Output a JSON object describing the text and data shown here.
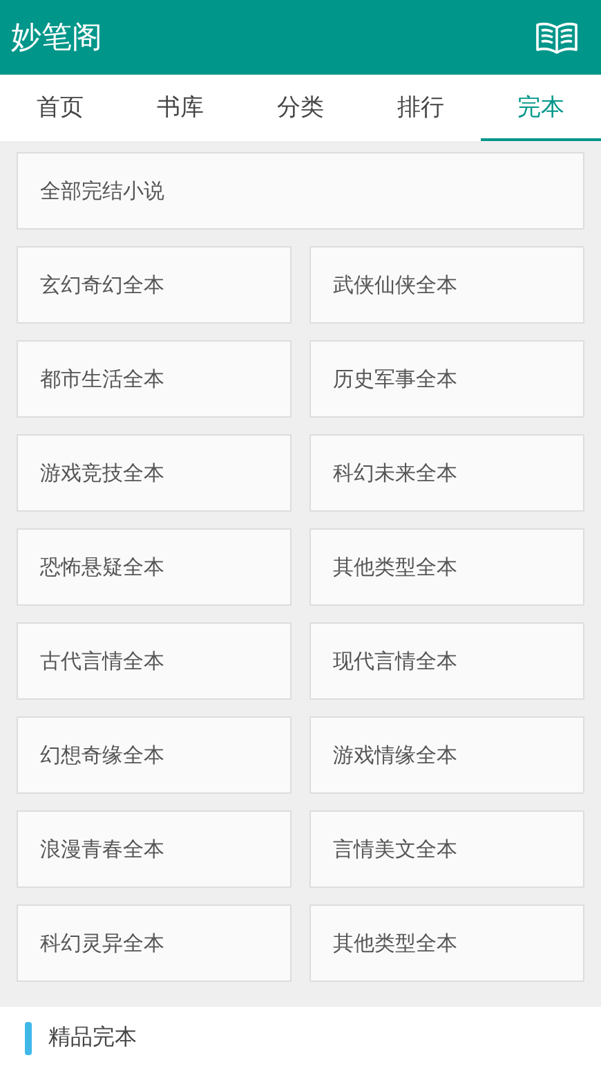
{
  "header": {
    "title": "妙笔阁"
  },
  "tabs": [
    {
      "label": "首页",
      "selected": false
    },
    {
      "label": "书库",
      "selected": false
    },
    {
      "label": "分类",
      "selected": false
    },
    {
      "label": "排行",
      "selected": false
    },
    {
      "label": "完本",
      "selected": true
    }
  ],
  "all_link": "全部完结小说",
  "categories": [
    "玄幻奇幻全本",
    "武侠仙侠全本",
    "都市生活全本",
    "历史军事全本",
    "游戏竞技全本",
    "科幻未来全本",
    "恐怖悬疑全本",
    "其他类型全本",
    "古代言情全本",
    "现代言情全本",
    "幻想奇缘全本",
    "游戏情缘全本",
    "浪漫青春全本",
    "言情美文全本",
    "科幻灵异全本",
    "其他类型全本"
  ],
  "section": {
    "title": "精品完本"
  }
}
